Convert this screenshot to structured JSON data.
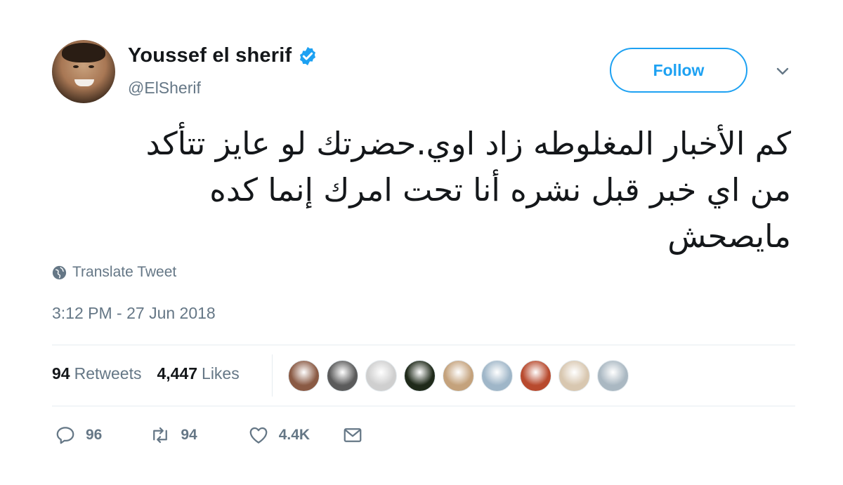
{
  "user": {
    "name": "Youssef el sherif",
    "handle": "@ElSherif"
  },
  "follow_label": "Follow",
  "tweet": {
    "lines": [
      "كم الأخبار المغلوطه زاد اوي.حضرتك لو عايز تتأكد",
      "من اي خبر قبل نشره أنا تحت امرك إنما كده",
      "مايصحش"
    ],
    "translate_label": "Translate Tweet",
    "timestamp": "3:12 PM - 27 Jun 2018"
  },
  "stats": {
    "retweets_count": "94",
    "retweets_label": "Retweets",
    "likes_count": "4,447",
    "likes_label": "Likes"
  },
  "likers": [
    {
      "color": "#8a5a44"
    },
    {
      "color": "#5b5b5b"
    },
    {
      "color": "#cfcfcf"
    },
    {
      "color": "#1f2a1a"
    },
    {
      "color": "#c4a27c"
    },
    {
      "color": "#9fb6c8"
    },
    {
      "color": "#b84a2e"
    },
    {
      "color": "#d8c7b0"
    },
    {
      "color": "#aab8c2"
    }
  ],
  "actions": {
    "reply_count": "96",
    "retweet_count": "94",
    "like_count": "4.4K"
  },
  "colors": {
    "accent": "#1da1f2",
    "muted": "#657786",
    "text": "#14171a"
  }
}
